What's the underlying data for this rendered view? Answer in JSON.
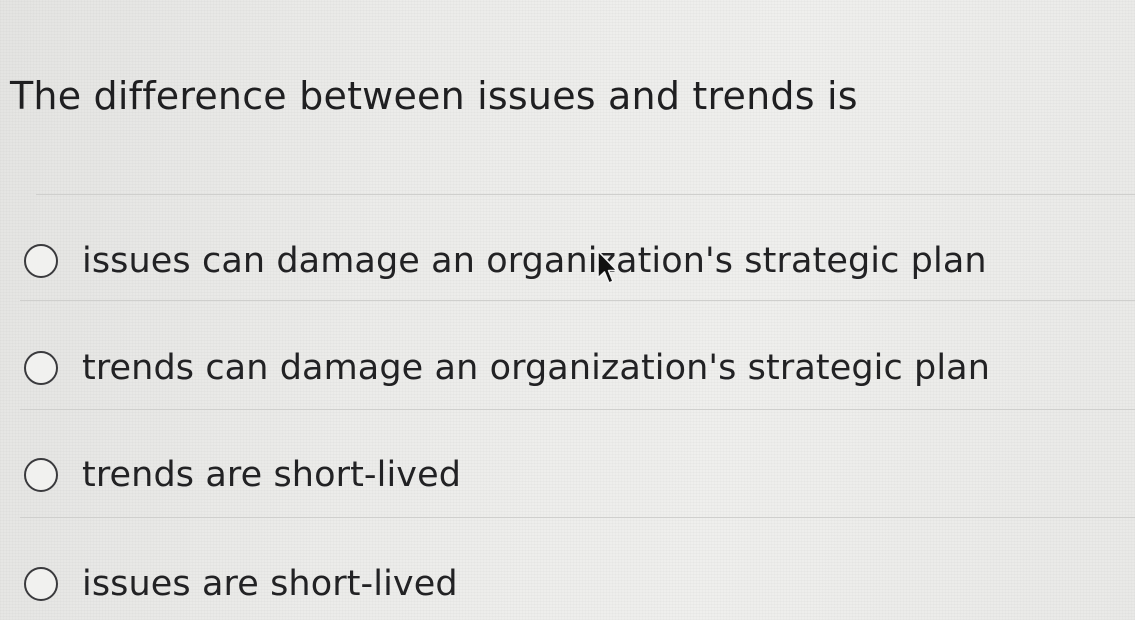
{
  "question": {
    "text": "The difference between issues and trends is"
  },
  "options": [
    {
      "label": "issues can damage an organization's strategic plan",
      "selected": false
    },
    {
      "label": "trends can damage an organization's strategic plan",
      "selected": false
    },
    {
      "label": "trends are short-lived",
      "selected": false
    },
    {
      "label": "issues are short-lived",
      "selected": false
    }
  ],
  "icons": {
    "cursor": "mouse-pointer-arrow-icon",
    "radio": "radio-button-unchecked-icon"
  },
  "colors": {
    "background": "#ececea",
    "text": "#222224",
    "divider": "#cfcfcd"
  }
}
